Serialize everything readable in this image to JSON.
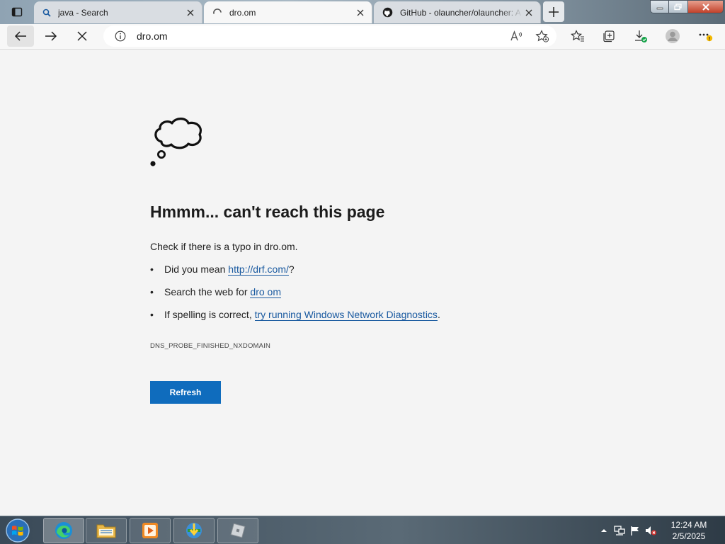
{
  "tabs": [
    {
      "title": "java - Search",
      "icon": "search-icon"
    },
    {
      "title": "dro.om",
      "icon": "loading-icon"
    },
    {
      "title": "GitHub - olauncher/olauncher: A",
      "icon": "github-icon"
    }
  ],
  "address_bar": {
    "url": "dro.om"
  },
  "error_page": {
    "title": "Hmmm... can't reach this page",
    "check_text": "Check if there is a typo in dro.om.",
    "suggestion1_prefix": "Did you mean ",
    "suggestion1_link": "http://drf.com/",
    "suggestion1_suffix": "?",
    "suggestion2_prefix": "Search the web for ",
    "suggestion2_link": "dro om",
    "suggestion3_prefix": "If spelling is correct, ",
    "suggestion3_link": "try running Windows Network Diagnostics",
    "suggestion3_suffix": ".",
    "error_code": "DNS_PROBE_FINISHED_NXDOMAIN",
    "refresh_label": "Refresh"
  },
  "taskbar": {
    "apps": [
      "edge-icon",
      "file-explorer-icon",
      "media-player-icon",
      "download-manager-icon",
      "roblox-icon"
    ],
    "time": "12:24 AM",
    "date": "2/5/2025"
  },
  "colors": {
    "accent": "#0f6cbd",
    "link": "#1a5aa0"
  }
}
